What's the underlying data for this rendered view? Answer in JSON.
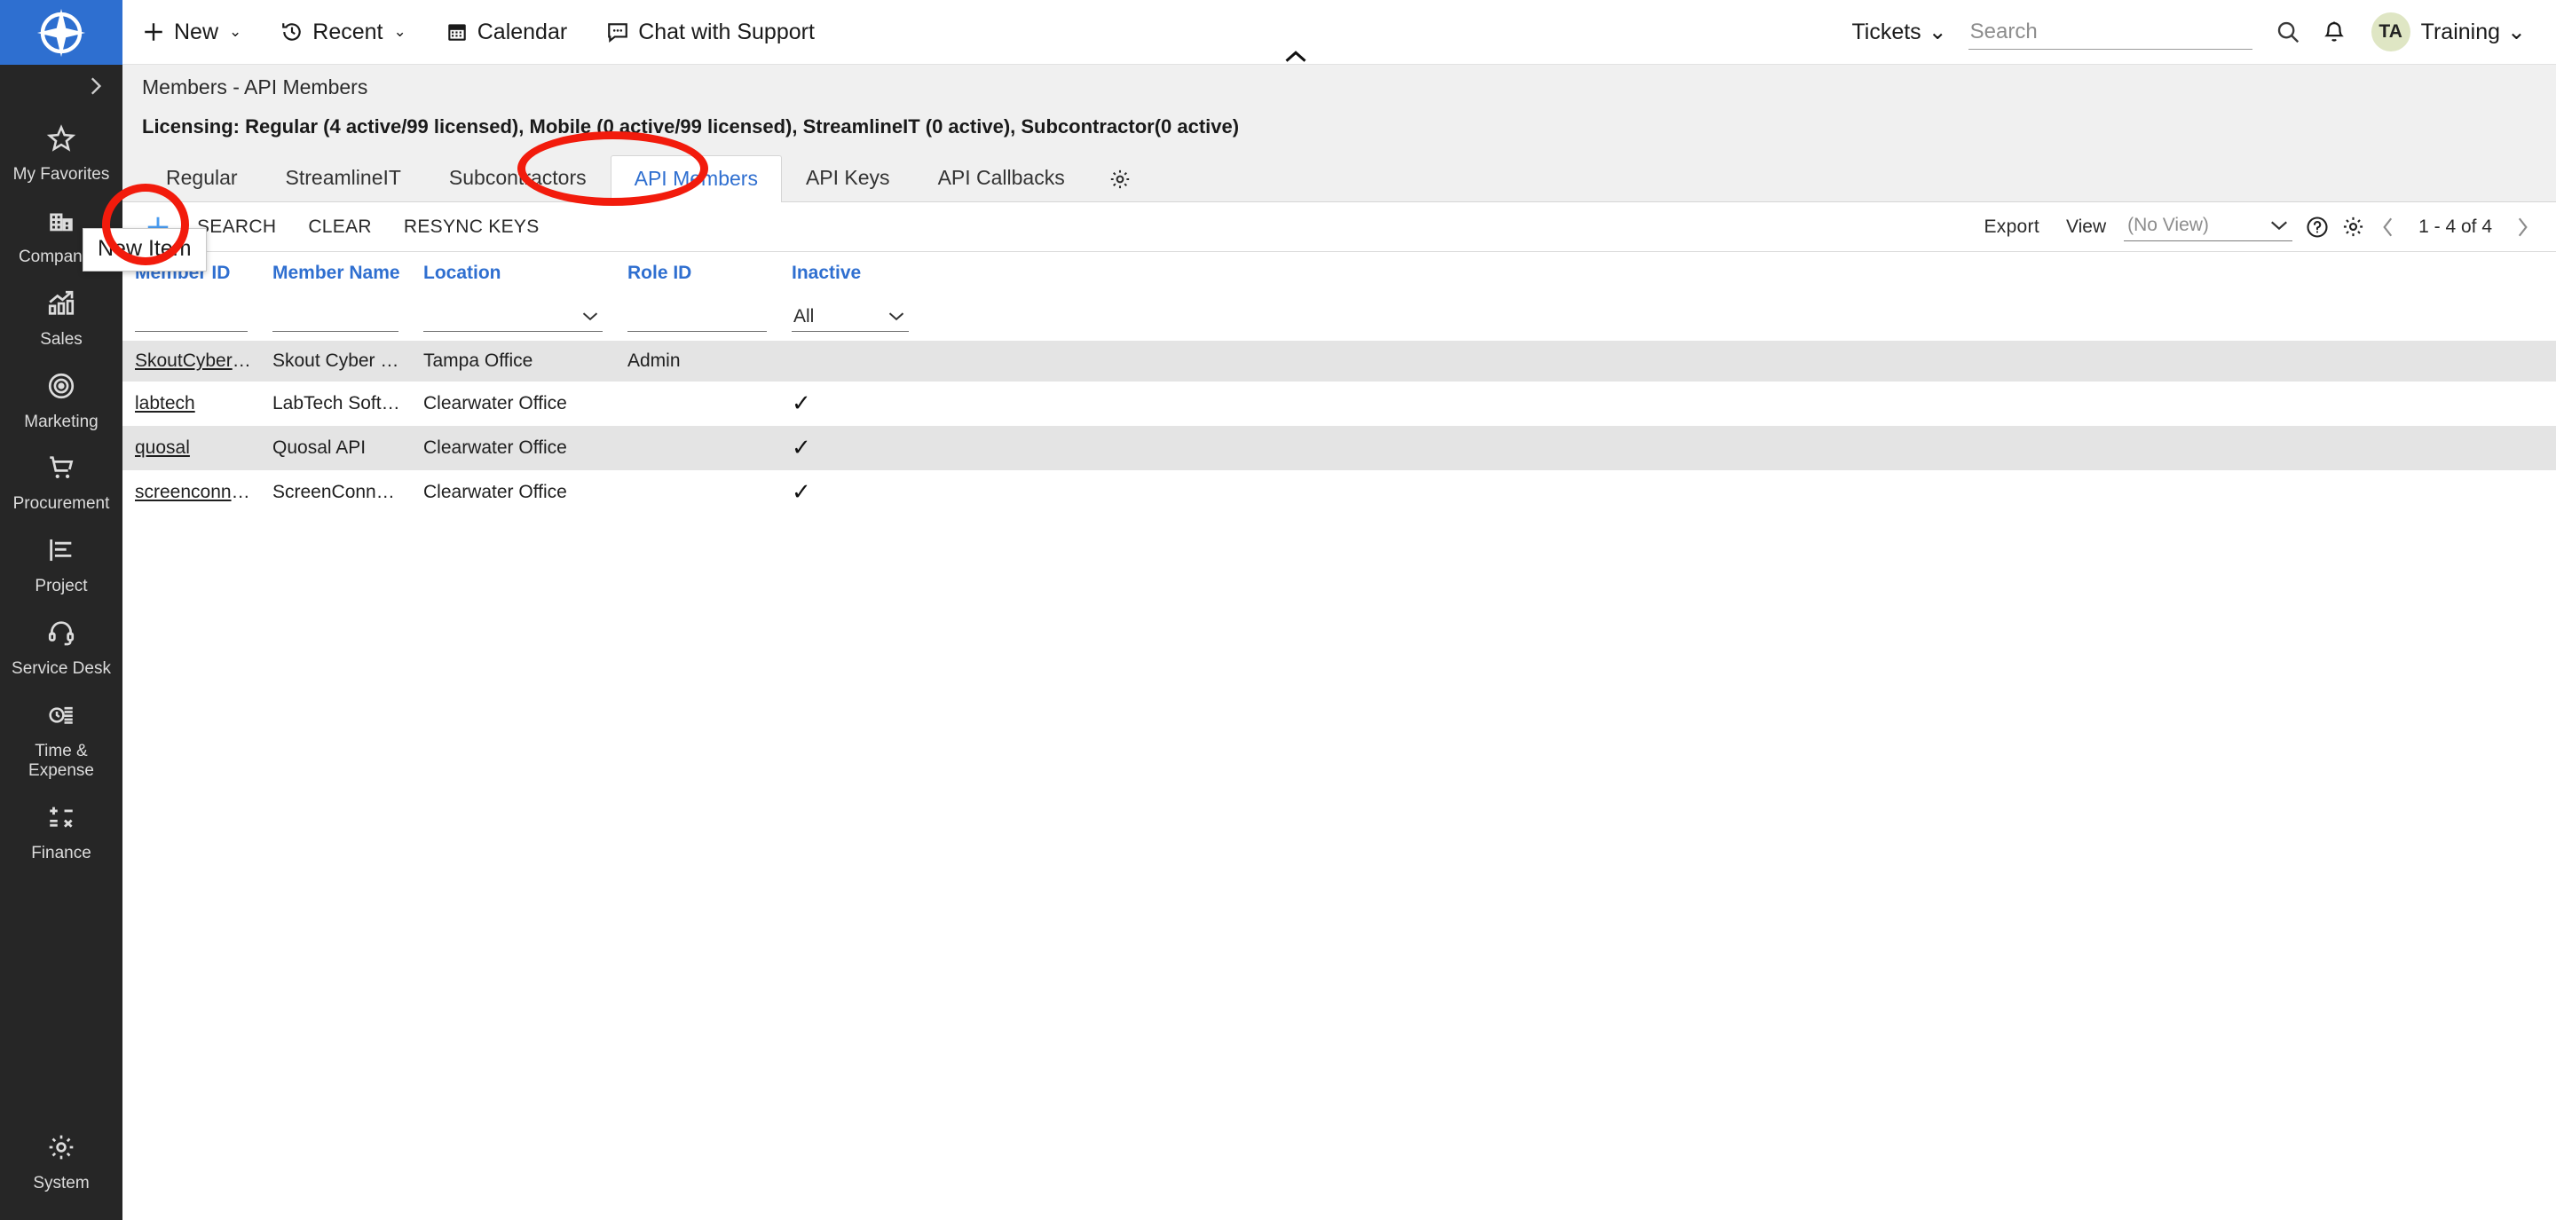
{
  "brand": {
    "logo_icon": "connectwise-compass-logo",
    "accent_blue": "#2f6fd0",
    "annotation_red": "#f21b0c"
  },
  "topnav": {
    "items": [
      {
        "label": "New",
        "icon": "plus-icon",
        "caret": "⌄"
      },
      {
        "label": "Recent",
        "icon": "history-clock-icon",
        "caret": "⌄"
      },
      {
        "label": "Calendar",
        "icon": "calendar-icon",
        "caret": ""
      },
      {
        "label": "Chat with Support",
        "icon": "chat-bubble-icon",
        "caret": ""
      }
    ],
    "collapse_icon": "chevron-up-icon",
    "tickets_label": "Tickets",
    "tickets_caret": "⌄",
    "search_placeholder": "Search",
    "search_value": "",
    "search_icon": "search-icon",
    "bell_icon": "bell-icon",
    "avatar_initials": "TA",
    "user_label": "Training",
    "user_caret": "⌄"
  },
  "sidebar": {
    "expand_icon": "chevron-right-icon",
    "items": [
      {
        "label": "My Favorites",
        "icon": "star-icon"
      },
      {
        "label": "Companies",
        "icon": "building-icon"
      },
      {
        "label": "Sales",
        "icon": "bar-chart-arrow-icon"
      },
      {
        "label": "Marketing",
        "icon": "target-icon"
      },
      {
        "label": "Procurement",
        "icon": "shopping-cart-icon"
      },
      {
        "label": "Project",
        "icon": "gantt-chart-icon"
      },
      {
        "label": "Service Desk",
        "icon": "headset-icon"
      },
      {
        "label": "Time & Expense",
        "icon": "clock-list-icon"
      },
      {
        "label": "Finance",
        "icon": "calculator-icon"
      }
    ],
    "bottom": {
      "label": "System",
      "icon": "gear-icon"
    }
  },
  "page": {
    "breadcrumb": "Members - API Members",
    "licensing": "Licensing: Regular (4 active/99 licensed), Mobile (0 active/99 licensed), StreamlineIT (0 active), Subcontractor(0 active)",
    "tabs": [
      {
        "label": "Regular",
        "active": false
      },
      {
        "label": "StreamlineIT",
        "active": false
      },
      {
        "label": "Subcontractors",
        "active": false
      },
      {
        "label": "API Members",
        "active": true
      },
      {
        "label": "API Keys",
        "active": false
      },
      {
        "label": "API Callbacks",
        "active": false
      }
    ],
    "tabs_gear_icon": "gear-icon"
  },
  "toolbar": {
    "new_icon": "plus-icon",
    "search_label": "SEARCH",
    "clear_label": "CLEAR",
    "resync_label": "RESYNC KEYS",
    "export_label": "Export",
    "view_label": "View",
    "view_value": "(No View)",
    "view_caret": "⌄",
    "help_icon": "question-circle-icon",
    "settings_icon": "gear-icon",
    "prev_icon": "chevron-left-icon",
    "next_icon": "chevron-right-icon",
    "pager_text": "1 - 4 of 4"
  },
  "tooltip": {
    "text": "New Item"
  },
  "table": {
    "columns": [
      {
        "label": "Member ID",
        "key": "member_id"
      },
      {
        "label": "Member Name",
        "key": "member_name"
      },
      {
        "label": "Location",
        "key": "location"
      },
      {
        "label": "Role ID",
        "key": "role_id"
      },
      {
        "label": "Inactive",
        "key": "inactive"
      }
    ],
    "filters": [
      {
        "value": "",
        "has_dropdown": false
      },
      {
        "value": "",
        "has_dropdown": false
      },
      {
        "value": "",
        "has_dropdown": true
      },
      {
        "value": "",
        "has_dropdown": false
      },
      {
        "value": "All",
        "has_dropdown": true
      }
    ],
    "rows": [
      {
        "member_id": "SkoutCyberSec",
        "member_name": "Skout Cyber Secur...",
        "location": "Tampa Office",
        "role_id": "Admin",
        "inactive": ""
      },
      {
        "member_id": "labtech",
        "member_name": "LabTech Software",
        "location": "Clearwater Office",
        "role_id": "",
        "inactive": "✓"
      },
      {
        "member_id": "quosal",
        "member_name": "Quosal API",
        "location": "Clearwater Office",
        "role_id": "",
        "inactive": "✓"
      },
      {
        "member_id": "screenconnect",
        "member_name": "ScreenConnect API",
        "location": "Clearwater Office",
        "role_id": "",
        "inactive": "✓"
      }
    ]
  }
}
